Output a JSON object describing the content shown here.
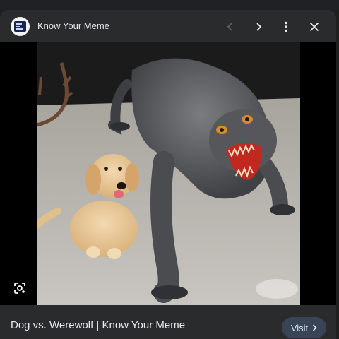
{
  "site": {
    "name": "Know Your Meme",
    "icon": "know-your-meme-logo-icon"
  },
  "header": {
    "prev_icon": "chevron-left-icon",
    "next_icon": "chevron-right-icon",
    "more_icon": "more-vert-icon",
    "close_icon": "close-icon"
  },
  "image": {
    "lens_icon": "lens-search-icon"
  },
  "footer": {
    "caption": "Dog vs. Werewolf | Know Your Meme",
    "visit_label": "Visit",
    "visit_icon": "chevron-right-icon"
  },
  "colors": {
    "panel": "#2a2b2d",
    "text": "#e8eaed",
    "muted_icon": "#5f6368",
    "visit_bg": "#394457",
    "visit_text": "#d2e3fc"
  }
}
